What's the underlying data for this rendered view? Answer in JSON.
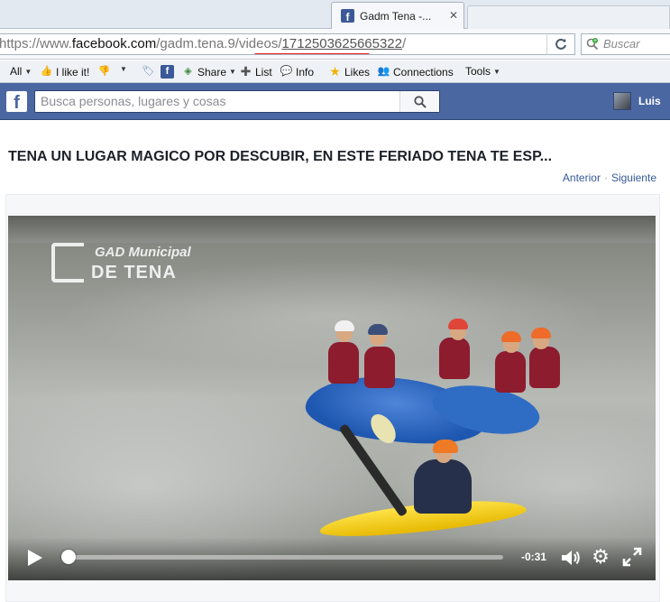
{
  "browser": {
    "tab_title": "Gadm Tena -...",
    "tab_close": "✕",
    "url_prefix": "https://www.",
    "url_host": "facebook.com",
    "url_path": "/gadm.tena.9/videos/",
    "url_video_id": "1712503625665322",
    "url_suffix": "/",
    "search_placeholder": "Buscar"
  },
  "toolbar": {
    "all": "All",
    "like": "I like it!",
    "share": "Share",
    "list": "List",
    "info": "Info",
    "likes": "Likes",
    "connections": "Connections",
    "tools": "Tools"
  },
  "facebook": {
    "logo": "f",
    "search_placeholder": "Busca personas, lugares y cosas",
    "user_name": "Luis"
  },
  "video_page": {
    "title": "TENA UN LUGAR MAGICO POR DESCUBIR, EN ESTE FERIADO TENA TE ESP...",
    "prev": "Anterior",
    "separator": "·",
    "next": "Siguiente",
    "watermark_line1": "GAD Municipal",
    "watermark_line2": "DE TENA"
  },
  "player": {
    "time_remaining": "-0:31",
    "progress_fraction": 0.01
  },
  "colors": {
    "facebook_blue": "#4b67a1",
    "link": "#365899",
    "annotation_red": "#e8201c"
  }
}
